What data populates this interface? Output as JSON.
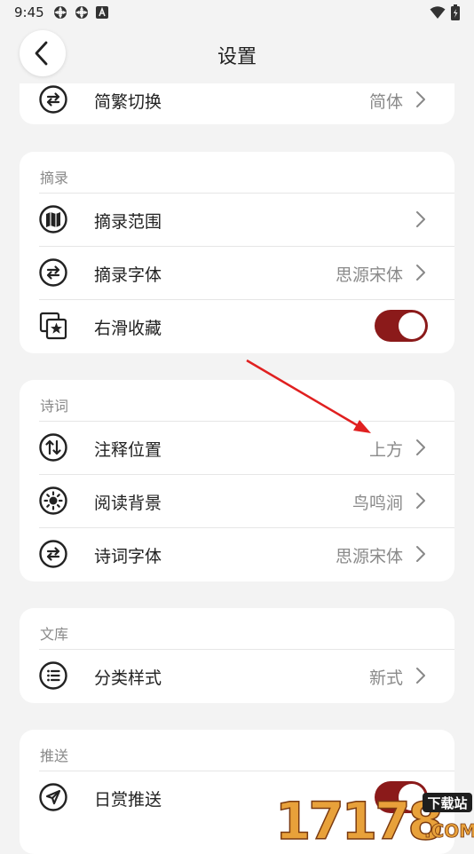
{
  "status_bar": {
    "time": "9:45"
  },
  "header": {
    "title": "设置"
  },
  "colors": {
    "accent": "#8b1a1a",
    "background": "#f3f3f3",
    "value_text": "#8a8a8a",
    "annotation_arrow": "#e02020"
  },
  "cards": [
    {
      "title": "",
      "rows": [
        {
          "icon": "swap-icon",
          "label": "简繁切换",
          "value": "简体",
          "control": "chevron"
        }
      ]
    },
    {
      "title": "摘录",
      "rows": [
        {
          "icon": "map-icon",
          "label": "摘录范围",
          "value": "",
          "control": "chevron"
        },
        {
          "icon": "swap-icon",
          "label": "摘录字体",
          "value": "思源宋体",
          "control": "chevron"
        },
        {
          "icon": "star-collection-icon",
          "label": "右滑收藏",
          "value": "",
          "control": "toggle",
          "on": true
        }
      ]
    },
    {
      "title": "诗词",
      "rows": [
        {
          "icon": "up-down-icon",
          "label": "注释位置",
          "value": "上方",
          "control": "chevron"
        },
        {
          "icon": "sun-icon",
          "label": "阅读背景",
          "value": "鸟鸣涧",
          "control": "chevron"
        },
        {
          "icon": "swap-icon",
          "label": "诗词字体",
          "value": "思源宋体",
          "control": "chevron"
        }
      ]
    },
    {
      "title": "文库",
      "rows": [
        {
          "icon": "list-icon",
          "label": "分类样式",
          "value": "新式",
          "control": "chevron"
        }
      ]
    },
    {
      "title": "推送",
      "rows": [
        {
          "icon": "send-icon",
          "label": "日赏推送",
          "value": "",
          "control": "toggle",
          "on": true
        }
      ]
    }
  ],
  "watermark": {
    "text": "17178",
    "badge": "下载站",
    "suffix": ".COM"
  }
}
